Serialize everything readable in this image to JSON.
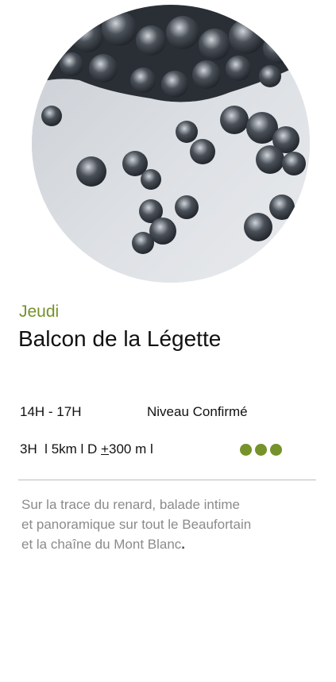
{
  "card": {
    "day": "Jeudi",
    "title": "Balcon de la Légette",
    "hours": "14H - 17H",
    "level": "Niveau Confirmé",
    "stats": {
      "duration": "3H",
      "sep1": "  l ",
      "distance": "5km",
      "sep2": " l D ",
      "plusminus": "+",
      "elevation": "300 m",
      "sep3": " l"
    },
    "difficulty": {
      "dots": 3,
      "max": 3,
      "color": "#76922a"
    },
    "description": {
      "line1": "Sur la trace du renard, balade intime",
      "line2": "et panoramique sur tout le Beaufortain",
      "line3": "et la chaîne du Mont Blanc",
      "period": "."
    }
  },
  "colors": {
    "accent": "#76922a",
    "text": "#111111",
    "muted": "#8b8b8b",
    "divider": "#bcbcbc"
  },
  "image": {
    "subject": "aerial view of snowy forest",
    "shape": "circle"
  }
}
